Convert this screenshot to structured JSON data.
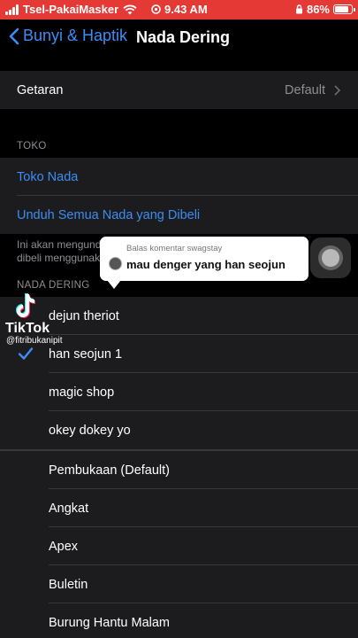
{
  "status_bar": {
    "carrier": "Tsel-PakaiMasker",
    "time": "9.43 AM",
    "battery": "86%",
    "battery_level": 0.86,
    "background_color": "#e53935"
  },
  "nav": {
    "back_label": "Bunyi & Haptik",
    "title": "Nada Dering",
    "accent_color": "#3a8ef6"
  },
  "vibration": {
    "label": "Getaran",
    "value": "Default"
  },
  "store": {
    "header": "TOKO",
    "items": [
      "Toko Nada",
      "Unduh Semua Nada yang Dibeli"
    ],
    "footnote_line1": "Ini akan mengund",
    "footnote_line2": "dibeli menggunak"
  },
  "ringtones": {
    "header": "NADA DERING",
    "custom": [
      {
        "label": "dejun theriot",
        "selected": false
      },
      {
        "label": "han seojun 1",
        "selected": true
      },
      {
        "label": "magic shop",
        "selected": false
      },
      {
        "label": "okey dokey yo",
        "selected": false
      }
    ],
    "builtin": [
      "Pembukaan (Default)",
      "Angkat",
      "Apex",
      "Buletin",
      "Burung Hantu Malam"
    ]
  },
  "overlay": {
    "reply_meta": "Balas komentar swagstay",
    "reply_text": "mau denger yang han seojun",
    "tiktok_brand": "TikTok",
    "tiktok_user": "@fitribukanipit"
  }
}
